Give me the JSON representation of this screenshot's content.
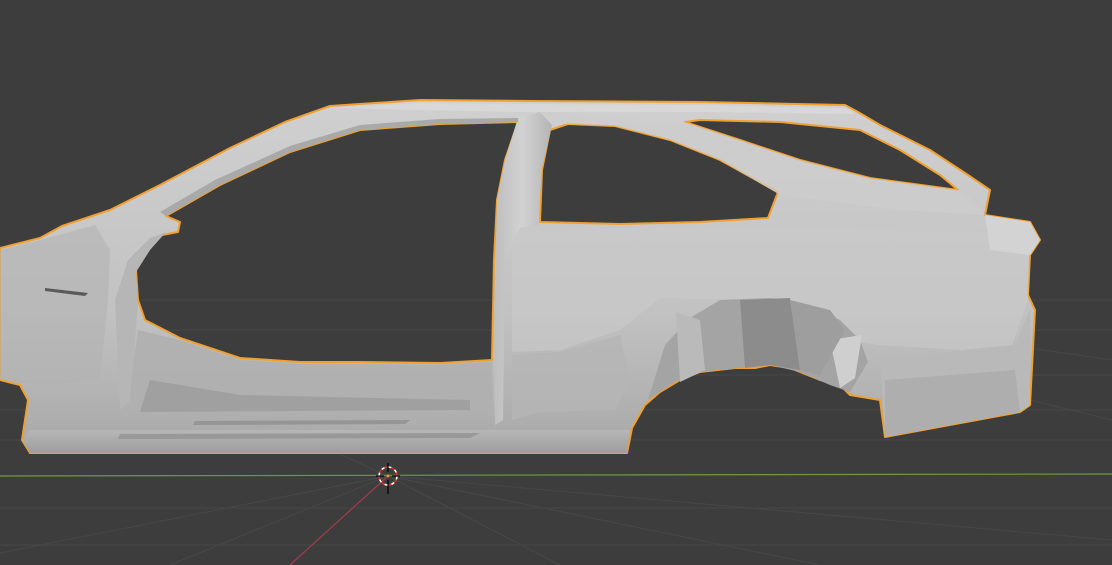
{
  "viewport": {
    "background_color": "#3d3d3d",
    "grid_line_color": "#474747",
    "x_axis_color": "#6f9a3c",
    "y_axis_color": "#a03c4c",
    "selection_outline_color": "#f0a030",
    "mesh_base_color": "#c4c4c4",
    "mesh_shadow_color": "#9a9a9a",
    "mesh_highlight_color": "#d6d6d6"
  },
  "scene": {
    "selected_object_icon": "car-body-shell-mesh",
    "cursor_icon": "3d-cursor-icon"
  }
}
